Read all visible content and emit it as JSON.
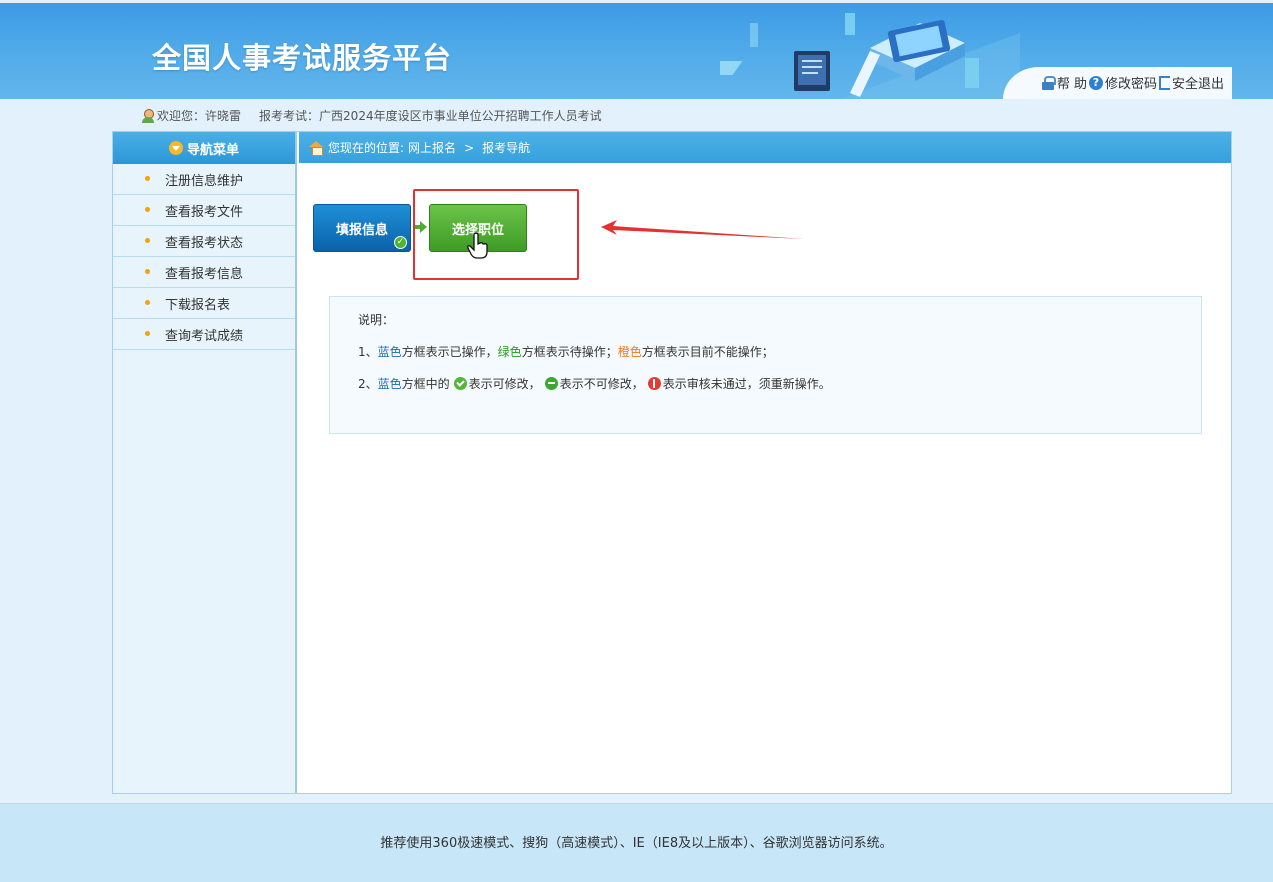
{
  "header": {
    "site_title": "全国人事考试服务平台",
    "links": {
      "help": "帮 助",
      "change_password": "修改密码",
      "logout": "安全退出"
    }
  },
  "userbar": {
    "welcome_label": "欢迎您：",
    "user_name": "许晓雷",
    "exam_label": "报考考试：",
    "exam_name": "广西2024年度设区市事业单位公开招聘工作人员考试"
  },
  "sidebar": {
    "title": "导航菜单",
    "items": [
      {
        "label": "注册信息维护"
      },
      {
        "label": "查看报考文件"
      },
      {
        "label": "查看报考状态"
      },
      {
        "label": "查看报考信息"
      },
      {
        "label": "下载报名表"
      },
      {
        "label": "查询考试成绩"
      }
    ]
  },
  "breadcrumb": {
    "prefix": "您现在的位置:",
    "level1": "网上报名",
    "separator": ">",
    "level2": "报考导航"
  },
  "steps": {
    "step1": {
      "label": "填报信息",
      "status": "done",
      "color": "#1a7bc8"
    },
    "step2": {
      "label": "选择职位",
      "status": "pending",
      "color": "#4fad31"
    }
  },
  "note": {
    "title": "说明：",
    "line1": {
      "num": "1、",
      "blue_word": "蓝色",
      "t1": "方框表示已操作，",
      "green_word": "绿色",
      "t2": "方框表示待操作；",
      "orange_word": "橙色",
      "t3": "方框表示目前不能操作；"
    },
    "line2": {
      "num": "2、",
      "blue_word": "蓝色",
      "t1": "方框中的",
      "t2": "表示可修改，",
      "t3": "表示不可修改，",
      "t4": "表示审核未通过，须重新操作。"
    }
  },
  "footer": {
    "text": "推荐使用360极速模式、搜狗（高速模式）、IE（IE8及以上版本）、谷歌浏览器访问系统。"
  },
  "colors": {
    "header_blue": "#3d9be6",
    "nav_blue": "#36a1dd",
    "highlight_red": "#e33232"
  }
}
